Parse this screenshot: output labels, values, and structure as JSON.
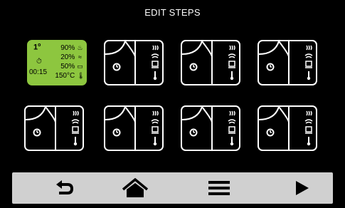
{
  "header": {
    "title": "EDIT STEPS"
  },
  "active_step": {
    "number": "1",
    "number_suffix": "o",
    "time": "00:15",
    "params": [
      {
        "value": "90%",
        "icon": "steam-icon"
      },
      {
        "value": "20%",
        "icon": "fan-icon"
      },
      {
        "value": "50%",
        "icon": "humidity-icon"
      },
      {
        "value": "150°C",
        "icon": "thermometer-icon"
      }
    ]
  },
  "steps": [
    {
      "index": 1,
      "state": "active"
    },
    {
      "index": 2,
      "state": "empty"
    },
    {
      "index": 3,
      "state": "empty"
    },
    {
      "index": 4,
      "state": "empty"
    },
    {
      "index": 5,
      "state": "empty"
    },
    {
      "index": 6,
      "state": "empty"
    },
    {
      "index": 7,
      "state": "empty"
    },
    {
      "index": 8,
      "state": "empty"
    }
  ],
  "bottom_bar": {
    "buttons": [
      {
        "name": "back",
        "icon": "undo-arrow-icon"
      },
      {
        "name": "home",
        "icon": "home-icon"
      },
      {
        "name": "menu",
        "icon": "menu-icon"
      },
      {
        "name": "start",
        "icon": "play-icon"
      }
    ]
  },
  "colors": {
    "accent": "#8dc63f",
    "background": "#000000",
    "bar": "#d0d0d0"
  }
}
